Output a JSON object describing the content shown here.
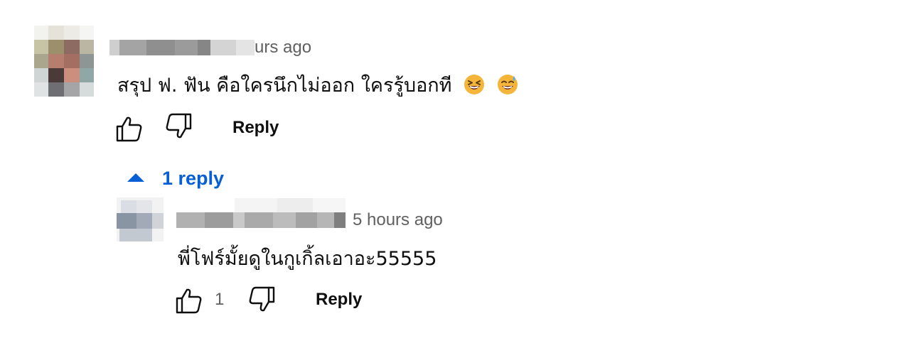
{
  "comment": {
    "timestamp": "urs ago",
    "text": "สรุป ฟ. ฟัน คือใครนึกไม่ออก ใครรู้บอกที",
    "emojis": [
      "grinning-squinting-face-icon",
      "grinning-face-with-sweat-icon"
    ],
    "reply_label": "Reply"
  },
  "replies_toggle": {
    "label": "1 reply",
    "color": "#065fd4"
  },
  "reply": {
    "timestamp": "5 hours ago",
    "text": "พี่โฟร์มั้ยดูในกูเกิ้ลเอาอะ55555",
    "like_count": "1",
    "reply_label": "Reply"
  }
}
